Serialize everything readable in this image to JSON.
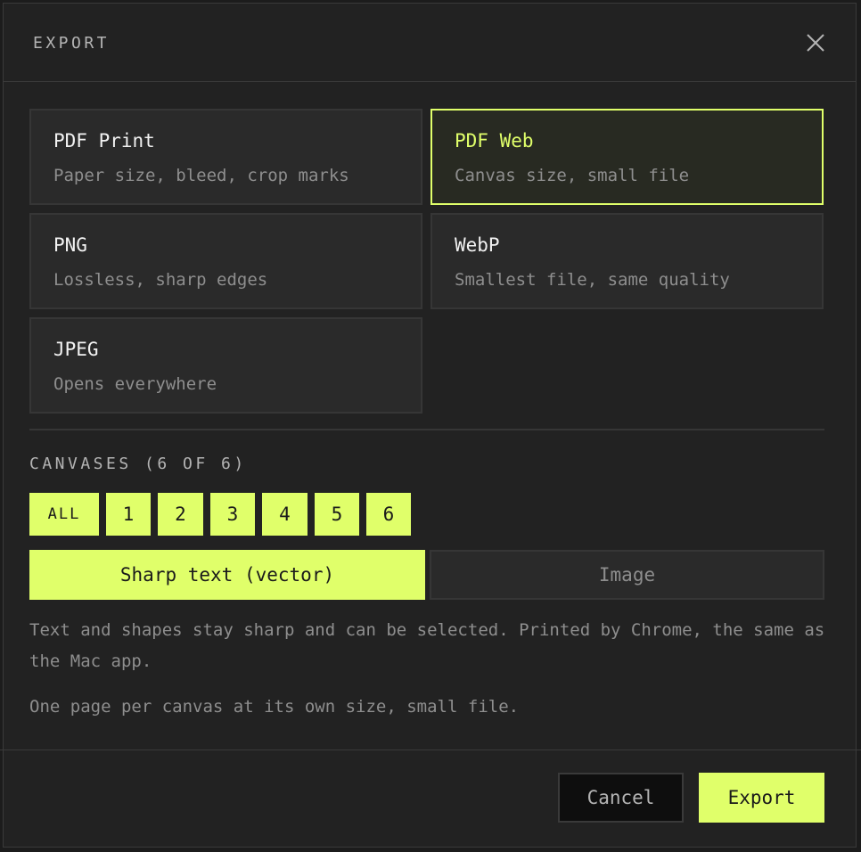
{
  "dialog": {
    "title": "EXPORT",
    "close_icon": "close-icon"
  },
  "formats": [
    {
      "name": "PDF Print",
      "desc": "Paper size, bleed, crop marks",
      "selected": false
    },
    {
      "name": "PDF Web",
      "desc": "Canvas size, small file",
      "selected": true
    },
    {
      "name": "PNG",
      "desc": "Lossless, sharp edges",
      "selected": false
    },
    {
      "name": "WebP",
      "desc": "Smallest file, same quality",
      "selected": false
    },
    {
      "name": "JPEG",
      "desc": "Opens everywhere",
      "selected": false
    }
  ],
  "canvases": {
    "label": "CANVASES (6 OF 6)",
    "buttons": [
      "ALL",
      "1",
      "2",
      "3",
      "4",
      "5",
      "6"
    ]
  },
  "mode": {
    "vector_label": "Sharp text (vector)",
    "image_label": "Image",
    "selected": "vector"
  },
  "description": {
    "line1": "Text and shapes stay sharp and can be selected. Printed by Chrome, the same as the Mac app.",
    "line2": "One page per canvas at its own size, small file."
  },
  "footer": {
    "cancel_label": "Cancel",
    "export_label": "Export"
  },
  "colors": {
    "accent": "#e0ff6a",
    "background": "#222222",
    "panel": "#2a2a2a"
  }
}
